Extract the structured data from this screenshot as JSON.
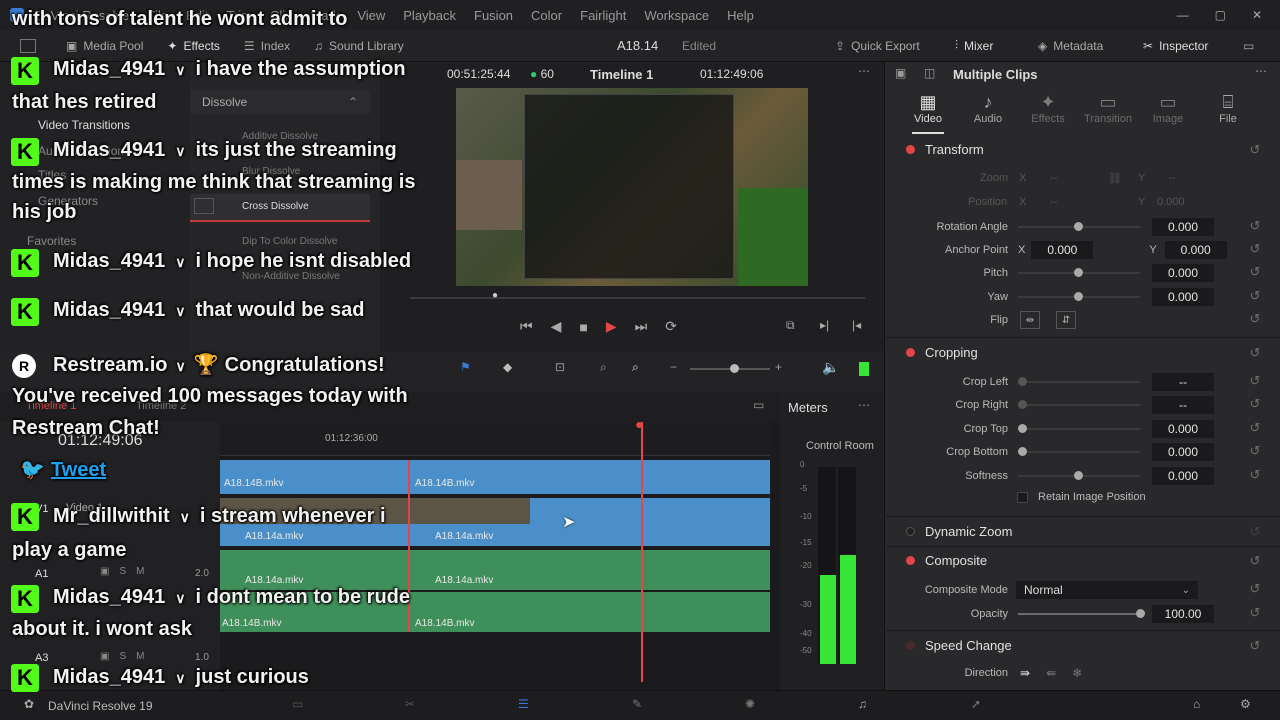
{
  "app": {
    "name": "DaVinci Resolve",
    "version_label": "DaVinci Resolve 19"
  },
  "menu": [
    "DaVinci Resolve",
    "File",
    "Edit",
    "Trim",
    "Clip",
    "Mark",
    "View",
    "Playback",
    "Fusion",
    "Color",
    "Fairlight",
    "Workspace",
    "Help"
  ],
  "toolbar": {
    "media_pool": "Media Pool",
    "effects": "Effects",
    "index": "Index",
    "sound_library": "Sound Library",
    "project_name": "A18.14",
    "project_status": "Edited",
    "quick_export": "Quick Export",
    "mixer": "Mixer",
    "metadata": "Metadata",
    "inspector": "Inspector"
  },
  "viewer": {
    "timecode_left": "00:51:25:44",
    "fps": "60",
    "timeline_name": "Timeline 1",
    "timecode_right": "01:12:49:06"
  },
  "effects": {
    "dissolve_header": "Dissolve",
    "tree": [
      "Video Transitions",
      "Audio Transitions",
      "Titles",
      "Generators",
      "Favorites"
    ],
    "items": [
      "Additive Dissolve",
      "Blur Dissolve",
      "Cross Dissolve",
      "Dip To Color Dissolve",
      "Non-Additive Dissolve"
    ]
  },
  "timeline": {
    "tab1": "Timeline 1",
    "tab2": "Timeline 2",
    "timecode": "01:12:49:06",
    "ruler_mark": "01:12:36:00",
    "tracks": {
      "v1": "V1",
      "video1": "Video 1",
      "a1": "A1",
      "a3": "A3",
      "a1_level": "2.0",
      "a3_level": "1.0"
    },
    "clips": {
      "top_a": "A18.14B.mkv",
      "top_b": "A18.14B.mkv",
      "v1_a": "A18.14a.mkv",
      "v1_b": "A18.14a.mkv",
      "a1_a": "A18.14a.mkv",
      "a1_b": "A18.14a.mkv",
      "a2_a": "A18.14B.mkv",
      "a2_b": "A18.14B.mkv"
    }
  },
  "meters": {
    "title": "Meters",
    "control_room": "Control Room",
    "scale": [
      "0",
      "-5",
      "-10",
      "-15",
      "-20",
      "-30",
      "-40",
      "-50"
    ]
  },
  "inspector": {
    "title": "Multiple Clips",
    "tabs": [
      "Video",
      "Audio",
      "Effects",
      "Transition",
      "Image",
      "File"
    ],
    "transform": {
      "title": "Transform",
      "zoom": "Zoom",
      "position": "Position",
      "x": "X",
      "y": "Y",
      "dash": "--",
      "zero": "0.000",
      "rotation_label": "Rotation Angle",
      "rotation": "0.000",
      "anchor_label": "Anchor Point",
      "anchor_x": "0.000",
      "anchor_y": "0.000",
      "pitch_label": "Pitch",
      "pitch": "0.000",
      "yaw_label": "Yaw",
      "yaw": "0.000",
      "flip_label": "Flip"
    },
    "cropping": {
      "title": "Cropping",
      "left_label": "Crop Left",
      "left": "--",
      "right_label": "Crop Right",
      "right": "--",
      "top_label": "Crop Top",
      "top": "0.000",
      "bottom_label": "Crop Bottom",
      "bottom": "0.000",
      "softness_label": "Softness",
      "softness": "0.000",
      "retain": "Retain Image Position"
    },
    "dynamic_zoom": "Dynamic Zoom",
    "composite": {
      "title": "Composite",
      "mode_label": "Composite Mode",
      "mode": "Normal",
      "opacity_label": "Opacity",
      "opacity": "100.00"
    },
    "speed_change": {
      "title": "Speed Change",
      "direction_label": "Direction"
    }
  },
  "chat": [
    {
      "user": "",
      "text": "with tons of talent he wont admit to"
    },
    {
      "user": "Midas_4941",
      "text": "i have the assumption"
    },
    {
      "user": "",
      "text": "that hes retired"
    },
    {
      "user": "Midas_4941",
      "text": "its just the streaming"
    },
    {
      "user": "",
      "text": "times is making me think that streaming is"
    },
    {
      "user": "",
      "text": "his job"
    },
    {
      "user": "Midas_4941",
      "text": "i hope he isnt disabled"
    },
    {
      "user": "Midas_4941",
      "text": "that would be sad"
    },
    {
      "user": "Restream.io",
      "text": "Congratulations!"
    },
    {
      "user": "",
      "text": "You've received 100 messages today with"
    },
    {
      "user": "",
      "text": "Restream Chat!"
    },
    {
      "user": "",
      "text": "Tweet"
    },
    {
      "user": "Mr_dillwithit",
      "text": "i stream whenever i"
    },
    {
      "user": "",
      "text": "play a game"
    },
    {
      "user": "Midas_4941",
      "text": "i dont mean to be rude"
    },
    {
      "user": "",
      "text": "about it. i wont ask"
    },
    {
      "user": "Midas_4941",
      "text": "just curious"
    }
  ],
  "colors": {
    "accent_red": "#e44545",
    "kick_green": "#53fc18",
    "clip_blue": "#4a8fc9",
    "audio_green": "#3f8f5a"
  }
}
